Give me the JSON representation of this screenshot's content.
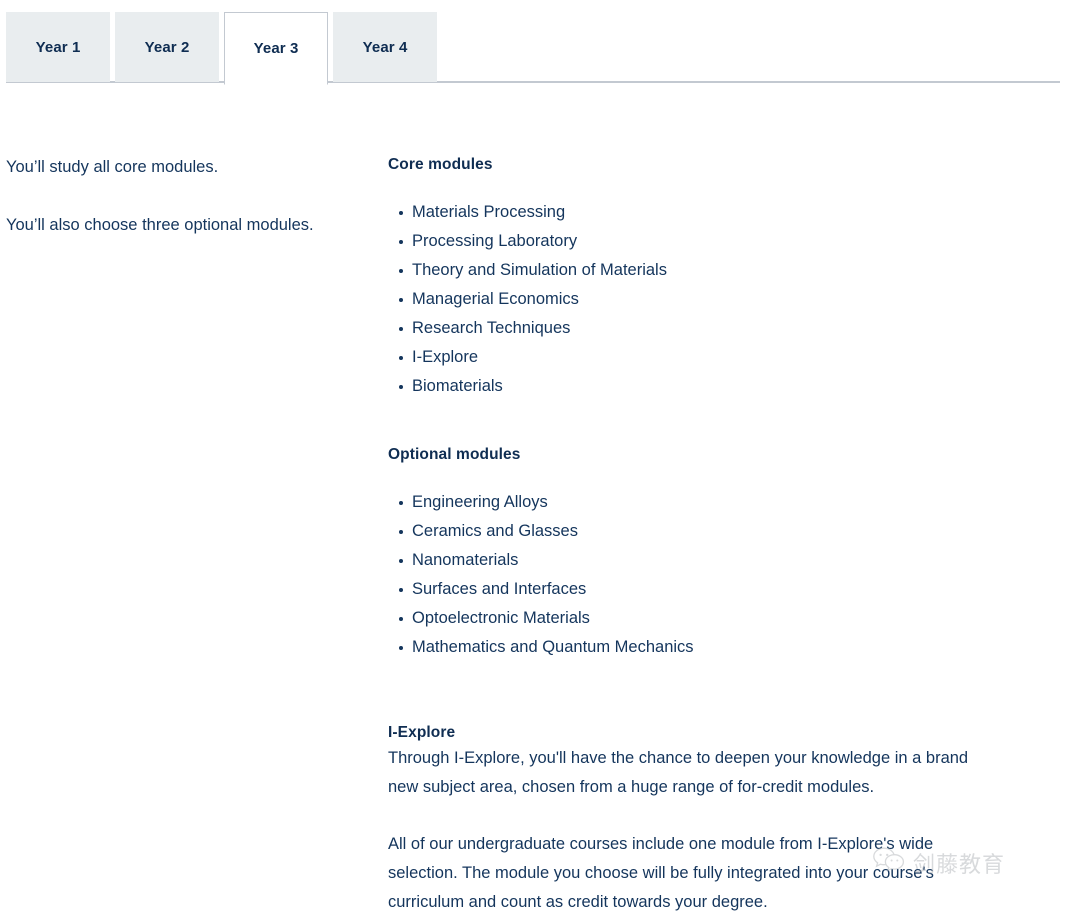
{
  "tabs": [
    {
      "label": "Year 1",
      "active": false
    },
    {
      "label": "Year 2",
      "active": false
    },
    {
      "label": "Year 3",
      "active": true
    },
    {
      "label": "Year 4",
      "active": false
    }
  ],
  "left_column": {
    "line_1": "You’ll study all core modules.",
    "line_2": "You’ll also choose three optional modules."
  },
  "core": {
    "heading": "Core modules",
    "modules": [
      "Materials Processing",
      "Processing Laboratory",
      "Theory and Simulation of Materials",
      "Managerial Economics",
      "Research Techniques",
      "I-Explore",
      "Biomaterials"
    ]
  },
  "optional": {
    "heading": "Optional modules",
    "modules": [
      "Engineering Alloys",
      "Ceramics and Glasses",
      "Nanomaterials",
      "Surfaces and Interfaces",
      "Optoelectronic Materials",
      "Mathematics and Quantum Mechanics"
    ]
  },
  "iexplore": {
    "heading": "I-Explore",
    "paragraph_1": "Through I-Explore, you'll have the chance to deepen your knowledge in a brand new subject area, chosen from a huge range of for-credit modules.",
    "paragraph_2": "All of our undergraduate courses include one module from I-Explore's wide selection. The module you choose will be fully integrated into your course's curriculum and count as credit towards your degree."
  },
  "watermark": {
    "icon": "wechat-speech-bubble-icon",
    "text": "剑藤教育"
  },
  "colors": {
    "heading_navy": "#0f2d52",
    "body_navy": "#14355c",
    "tab_inactive_bg": "#e9edef",
    "tab_active_bg": "#ffffff",
    "tab_border": "#c3c9d1",
    "watermark_gray": "#b9bcc0"
  }
}
